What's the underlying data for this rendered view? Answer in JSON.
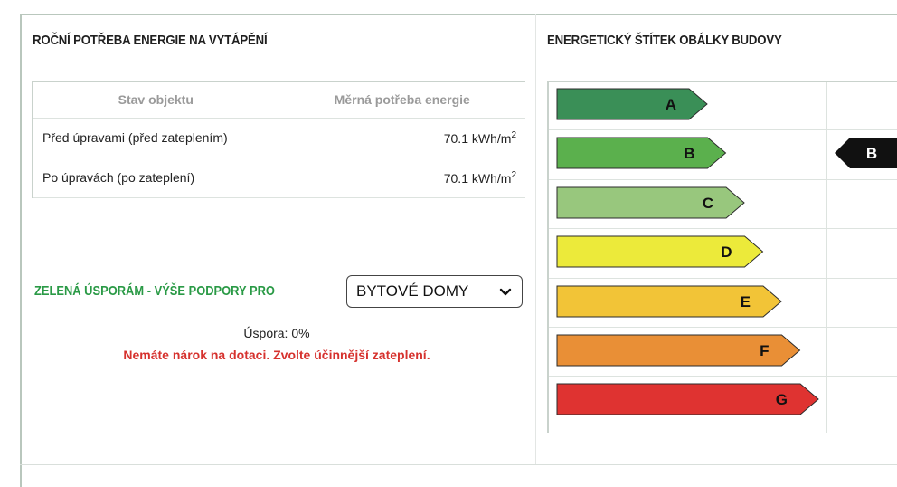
{
  "left_panel": {
    "title": "ROČNÍ POTŘEBA ENERGIE NA VYTÁPĚNÍ",
    "table": {
      "headers": [
        "Stav objektu",
        "Měrná potřeba energie"
      ],
      "rows": [
        {
          "label": "Před úpravami (před zateplením)",
          "value": "70.1 kWh/m",
          "unit_exp": "2"
        },
        {
          "label": "Po úpravách (po zateplení)",
          "value": "70.1 kWh/m",
          "unit_exp": "2"
        }
      ]
    },
    "support": {
      "label": "ZELENÁ ÚSPORÁM - VÝŠE PODPORY PRO",
      "select_value": "BYTOVÉ DOMY",
      "saving_text": "Úspora: 0%",
      "warning_text": "Nemáte nárok na dotaci. Zvolte účinnější zateplení."
    }
  },
  "right_panel": {
    "title": "ENERGETICKÝ ŠTÍTEK OBÁLKY BUDOVY",
    "classes": [
      {
        "letter": "A",
        "color": "#3a8f57"
      },
      {
        "letter": "B",
        "color": "#5bb04d"
      },
      {
        "letter": "C",
        "color": "#98c77d"
      },
      {
        "letter": "D",
        "color": "#ecea3a"
      },
      {
        "letter": "E",
        "color": "#f2c437"
      },
      {
        "letter": "F",
        "color": "#e98f36"
      },
      {
        "letter": "G",
        "color": "#df3331"
      }
    ],
    "current_rating": "B"
  },
  "icons": {
    "select_chevron": "chevron-down-icon"
  }
}
